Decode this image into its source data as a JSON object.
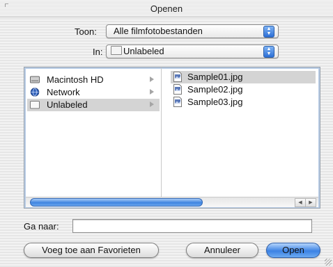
{
  "window": {
    "title": "Openen"
  },
  "toon": {
    "label": "Toon:",
    "selected": "Alle filmfotobestanden"
  },
  "location": {
    "label": "In:",
    "selected": "Unlabeled"
  },
  "volumes": [
    {
      "label": "Macintosh HD",
      "icon": "hard-drive-icon"
    },
    {
      "label": "Network",
      "icon": "network-globe-icon"
    },
    {
      "label": "Unlabeled",
      "icon": "folder-icon",
      "selected": true
    }
  ],
  "files": [
    {
      "label": "Sample01.jpg",
      "icon": "jpeg-file-icon",
      "selected": true
    },
    {
      "label": "Sample02.jpg",
      "icon": "jpeg-file-icon"
    },
    {
      "label": "Sample03.jpg",
      "icon": "jpeg-file-icon"
    }
  ],
  "goto": {
    "label": "Ga naar:",
    "value": ""
  },
  "buttons": {
    "favorites": "Voeg toe aan Favorieten",
    "cancel": "Annuleer",
    "open": "Open"
  },
  "colors": {
    "accent_blue": "#3b82e4",
    "selection_gray": "#d4d4d4"
  }
}
